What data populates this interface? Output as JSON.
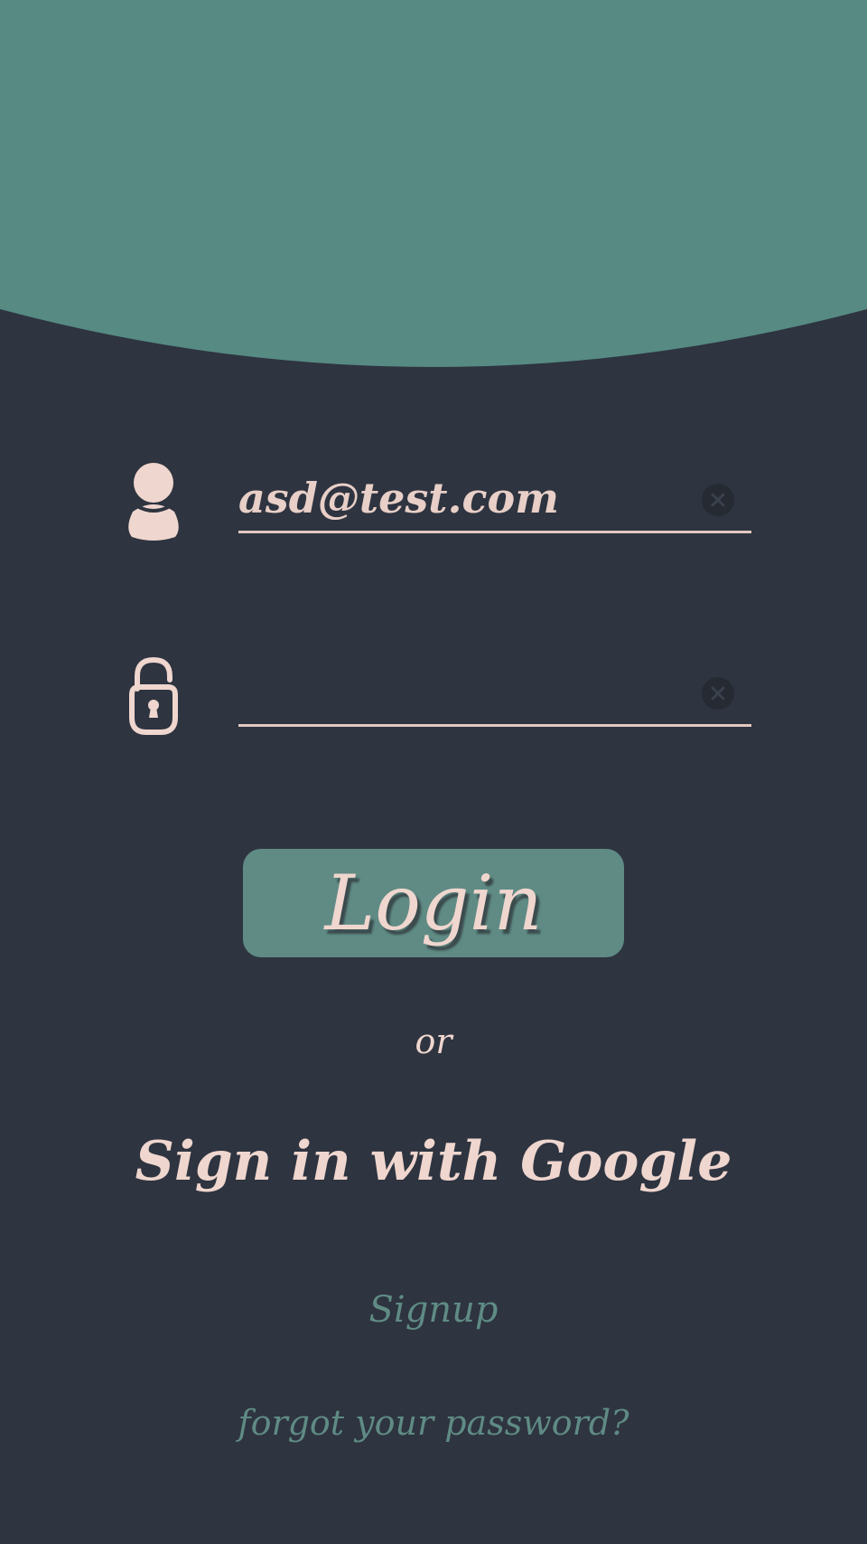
{
  "colors": {
    "background": "#2e3440",
    "header": "#568a83",
    "accent": "#efd6ce",
    "button": "#5f8b84",
    "link": "#5f8b84"
  },
  "email_field": {
    "icon": "user-icon",
    "value": "asd@test.com",
    "clear_icon": "clear-icon"
  },
  "password_field": {
    "icon": "unlocked-padlock-icon",
    "value": "",
    "clear_icon": "clear-icon"
  },
  "login_button": {
    "label": "Login"
  },
  "divider_text": "or",
  "google_signin": {
    "label": "Sign in with Google"
  },
  "signup_link": {
    "label": "Signup"
  },
  "forgot_password_link": {
    "label": "forgot your password?"
  }
}
